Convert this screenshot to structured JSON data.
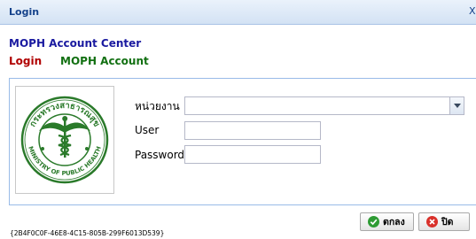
{
  "window": {
    "title": "Login",
    "close_label": "X"
  },
  "header": {
    "app_name": "MOPH Account Center",
    "login_label": "Login",
    "account_label": "MOPH Account"
  },
  "form": {
    "unit_label": "หน่วยงาน",
    "unit_value": "",
    "user_label": "User",
    "user_value": "",
    "password_label": "Password",
    "password_value": ""
  },
  "logo": {
    "top_text": "กระทรวงสาธารณสุข",
    "bottom_text": "MINISTRY OF PUBLIC HEALTH",
    "color": "#2a7a2a"
  },
  "footer": {
    "guid": "{2B4F0C0F-46E8-4C15-805B-299F6013D539}",
    "ok_label": "ตกลง",
    "close_label": "ปิด"
  }
}
